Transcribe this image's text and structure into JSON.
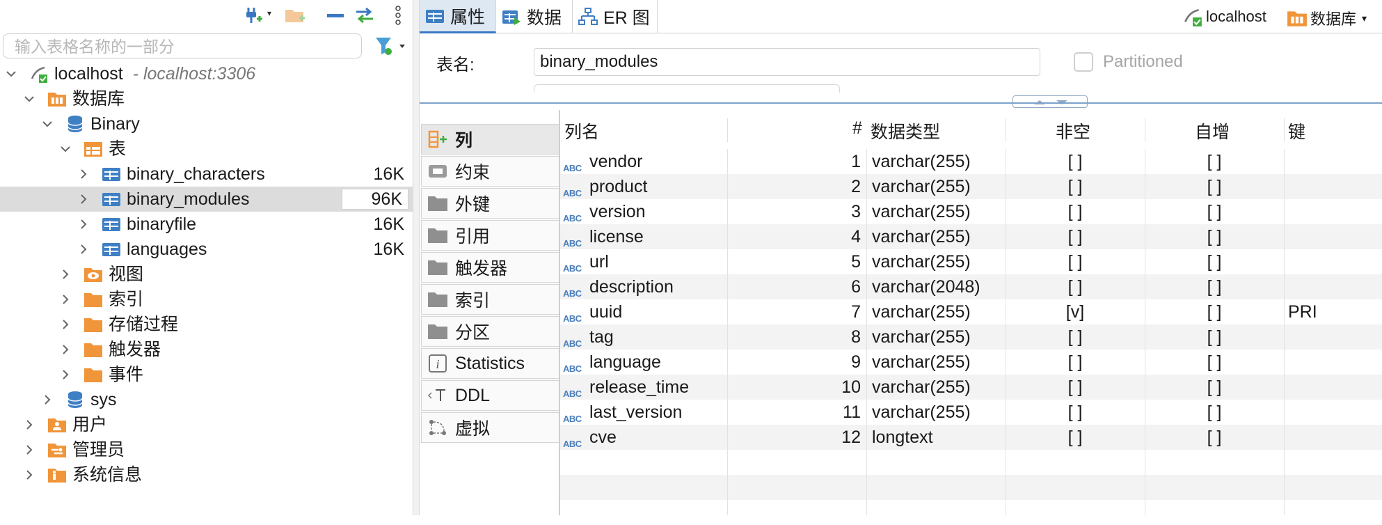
{
  "left_panel": {
    "search_placeholder": "输入表格名称的一部分",
    "tree": {
      "connection": {
        "label": "localhost",
        "sub": "- localhost:3306"
      },
      "databases": "数据库",
      "binary_db": "Binary",
      "tables_folder": "表",
      "tables": [
        {
          "name": "binary_characters",
          "size": "16K"
        },
        {
          "name": "binary_modules",
          "size": "96K"
        },
        {
          "name": "binaryfile",
          "size": "16K"
        },
        {
          "name": "languages",
          "size": "16K"
        }
      ],
      "binary_children": [
        "视图",
        "索引",
        "存储过程",
        "触发器",
        "事件"
      ],
      "sys_db": "sys",
      "top_folders": [
        "用户",
        "管理员",
        "系统信息"
      ]
    }
  },
  "editor": {
    "tabs": [
      "属性",
      "数据",
      "ER 图"
    ],
    "conn_name": "localhost",
    "conn_db": "数据库",
    "table_name_label": "表名:",
    "table_name_value": "binary_modules",
    "partitioned_label": "Partitioned",
    "side_tabs": [
      "列",
      "约束",
      "外键",
      "引用",
      "触发器",
      "索引",
      "分区",
      "Statistics",
      "DDL",
      "虚拟"
    ],
    "columns_header": {
      "name": "列名",
      "num": "#",
      "type": "数据类型",
      "not_null": "非空",
      "auto_inc": "自增",
      "key": "键"
    },
    "columns": [
      {
        "name": "vendor",
        "num": "1",
        "type": "varchar(255)",
        "not_null": "[ ]",
        "auto_inc": "[ ]",
        "key": ""
      },
      {
        "name": "product",
        "num": "2",
        "type": "varchar(255)",
        "not_null": "[ ]",
        "auto_inc": "[ ]",
        "key": ""
      },
      {
        "name": "version",
        "num": "3",
        "type": "varchar(255)",
        "not_null": "[ ]",
        "auto_inc": "[ ]",
        "key": ""
      },
      {
        "name": "license",
        "num": "4",
        "type": "varchar(255)",
        "not_null": "[ ]",
        "auto_inc": "[ ]",
        "key": ""
      },
      {
        "name": "url",
        "num": "5",
        "type": "varchar(255)",
        "not_null": "[ ]",
        "auto_inc": "[ ]",
        "key": ""
      },
      {
        "name": "description",
        "num": "6",
        "type": "varchar(2048)",
        "not_null": "[ ]",
        "auto_inc": "[ ]",
        "key": ""
      },
      {
        "name": "uuid",
        "num": "7",
        "type": "varchar(255)",
        "not_null": "[v]",
        "auto_inc": "[ ]",
        "key": "PRI"
      },
      {
        "name": "tag",
        "num": "8",
        "type": "varchar(255)",
        "not_null": "[ ]",
        "auto_inc": "[ ]",
        "key": ""
      },
      {
        "name": "language",
        "num": "9",
        "type": "varchar(255)",
        "not_null": "[ ]",
        "auto_inc": "[ ]",
        "key": ""
      },
      {
        "name": "release_time",
        "num": "10",
        "type": "varchar(255)",
        "not_null": "[ ]",
        "auto_inc": "[ ]",
        "key": ""
      },
      {
        "name": "last_version",
        "num": "11",
        "type": "varchar(255)",
        "not_null": "[ ]",
        "auto_inc": "[ ]",
        "key": ""
      },
      {
        "name": "cve",
        "num": "12",
        "type": "longtext",
        "not_null": "[ ]",
        "auto_inc": "[ ]",
        "key": ""
      }
    ],
    "type_badge": "ABC"
  },
  "colors": {
    "accent_blue": "#3a78c2",
    "folder_orange": "#f0953a",
    "table_blue": "#3f7fc4",
    "add_green": "#3fae3f"
  }
}
